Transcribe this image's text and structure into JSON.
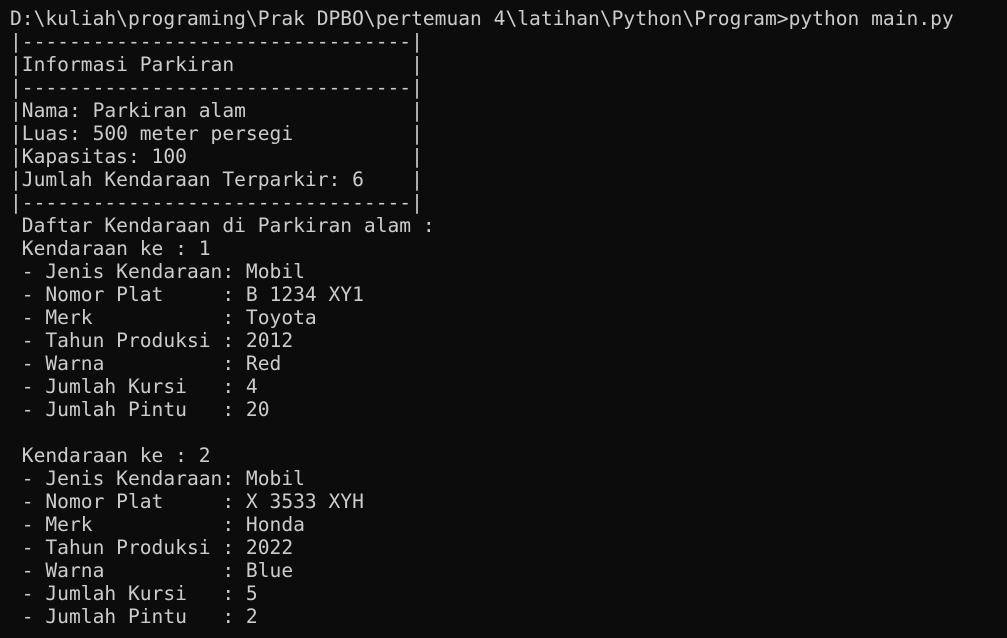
{
  "terminal": {
    "prompt_line": "D:\\kuliah\\programing\\Prak DPBO\\pertemuan 4\\latihan\\Python\\Program>python main.py",
    "box": {
      "border": "|---------------------------------|",
      "title": "|Informasi Parkiran               |",
      "nama": "|Nama: Parkiran alam              |",
      "luas": "|Luas: 500 meter persegi          |",
      "kapasitas": "|Kapasitas: 100                   |",
      "jumlah": "|Jumlah Kendaraan Terparkir: 6    |"
    },
    "daftar_heading": " Daftar Kendaraan di Parkiran alam :",
    "vehicles": [
      {
        "header": " Kendaraan ke : 1",
        "jenis": " - Jenis Kendaraan: Mobil",
        "plat": " - Nomor Plat     : B 1234 XY1",
        "merk": " - Merk           : Toyota",
        "tahun": " - Tahun Produksi : 2012",
        "warna": " - Warna          : Red",
        "kursi": " - Jumlah Kursi   : 4",
        "pintu": " - Jumlah Pintu   : 20"
      },
      {
        "header": " Kendaraan ke : 2",
        "jenis": " - Jenis Kendaraan: Mobil",
        "plat": " - Nomor Plat     : X 3533 XYH",
        "merk": " - Merk           : Honda",
        "tahun": " - Tahun Produksi : 2022",
        "warna": " - Warna          : Blue",
        "kursi": " - Jumlah Kursi   : 5",
        "pintu": " - Jumlah Pintu   : 2"
      }
    ]
  },
  "colors": {
    "background": "#0c0c0c",
    "text": "#cccccc"
  }
}
